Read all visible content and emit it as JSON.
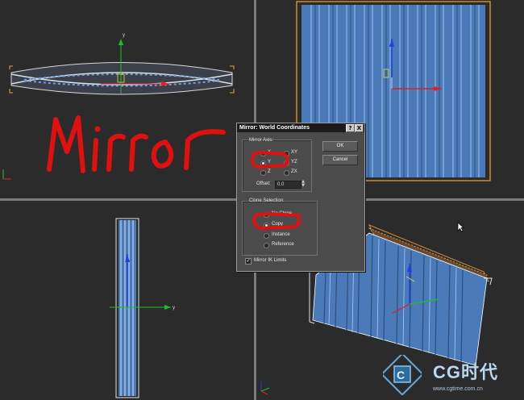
{
  "dialog": {
    "title": "Mirror: World Coordinates",
    "help_button": "?",
    "close_button": "X",
    "mirror_axis": {
      "label": "Mirror Axis:",
      "options": [
        "X",
        "Y",
        "Z",
        "XY",
        "YZ",
        "ZX"
      ],
      "selected": "Y"
    },
    "offset": {
      "label": "Offset:",
      "value": "0.0"
    },
    "clone_selection": {
      "label": "Clone Selection:",
      "options": [
        "No Clone",
        "Copy",
        "Instance",
        "Reference"
      ],
      "selected": "Copy"
    },
    "mirror_ik": {
      "label": "Mirror IK Limits",
      "checked": true
    },
    "ok_label": "OK",
    "cancel_label": "Cancel"
  },
  "annotation": {
    "text": "Mirror",
    "color": "#e01010"
  },
  "axes": {
    "y_label": "y",
    "x_label": "x"
  },
  "watermark": {
    "brand": "CG时代",
    "url": "www.cgtime.com.cn"
  },
  "colors": {
    "viewport_bg": "#2b2b2b",
    "object_blue": "#4a7ab8",
    "selection_orange": "#d08a30",
    "axis_red": "#e02020",
    "axis_green": "#20c020",
    "axis_blue": "#2040e0"
  }
}
